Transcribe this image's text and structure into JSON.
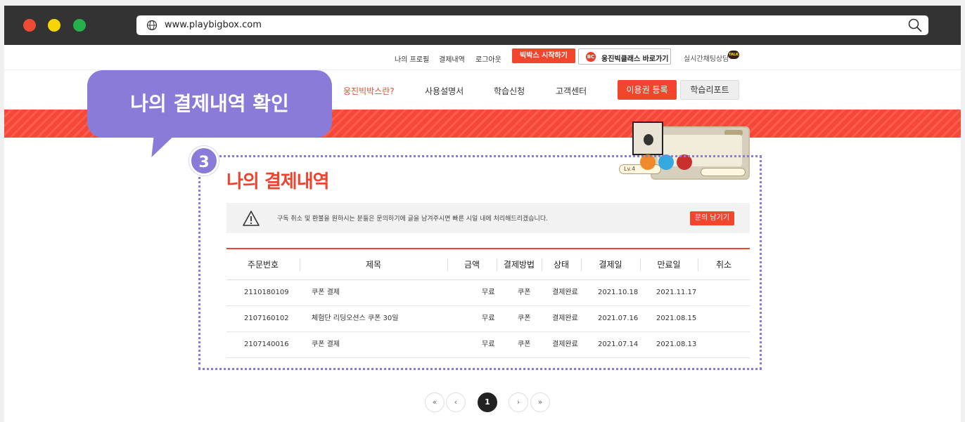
{
  "browser": {
    "url": "www.playbigbox.com"
  },
  "util_links": {
    "profile": "나의 프로필",
    "payments": "결제내역",
    "logout": "로그아웃",
    "start": "빅박스 시작하기",
    "bigclass": "웅진빅클래스 바로가기",
    "bigclass_logo": "BC",
    "chat": "실시간채팅상담",
    "talk": "TALK"
  },
  "nav": {
    "about": "웅진빅박스란?",
    "manual": "사용설명서",
    "apply": "학습신청",
    "support": "고객센터",
    "voucher": "이용권 등록",
    "report": "학습리포트"
  },
  "illustration": {
    "level": "Lv.4"
  },
  "callout": {
    "text": "나의 결제내역 확인",
    "step": "3"
  },
  "page_title": "나의 결제내역",
  "notice": {
    "text": "구독 취소 및 환불을 원하시는 분들은 문의하기에 글을 남겨주시면 빠른 시일 내에 처리해드리겠습니다.",
    "button": "문의 남기기"
  },
  "table": {
    "headers": [
      "주문번호",
      "제목",
      "금액",
      "결제방법",
      "상태",
      "결제일",
      "만료일",
      "취소"
    ],
    "rows": [
      [
        "2110180109",
        "쿠폰 결제",
        "무료",
        "쿠폰",
        "결제완료",
        "2021.10.18",
        "2021.11.17",
        ""
      ],
      [
        "2107160102",
        "체험단 리딩오션스 쿠폰 30일",
        "무료",
        "쿠폰",
        "결제완료",
        "2021.07.16",
        "2021.08.15",
        ""
      ],
      [
        "2107140016",
        "쿠폰 결제",
        "무료",
        "쿠폰",
        "결제완료",
        "2021.07.14",
        "2021.08.13",
        ""
      ]
    ]
  },
  "pagination": {
    "first": "«",
    "prev": "‹",
    "current": "1",
    "next": "›",
    "last": "»"
  }
}
